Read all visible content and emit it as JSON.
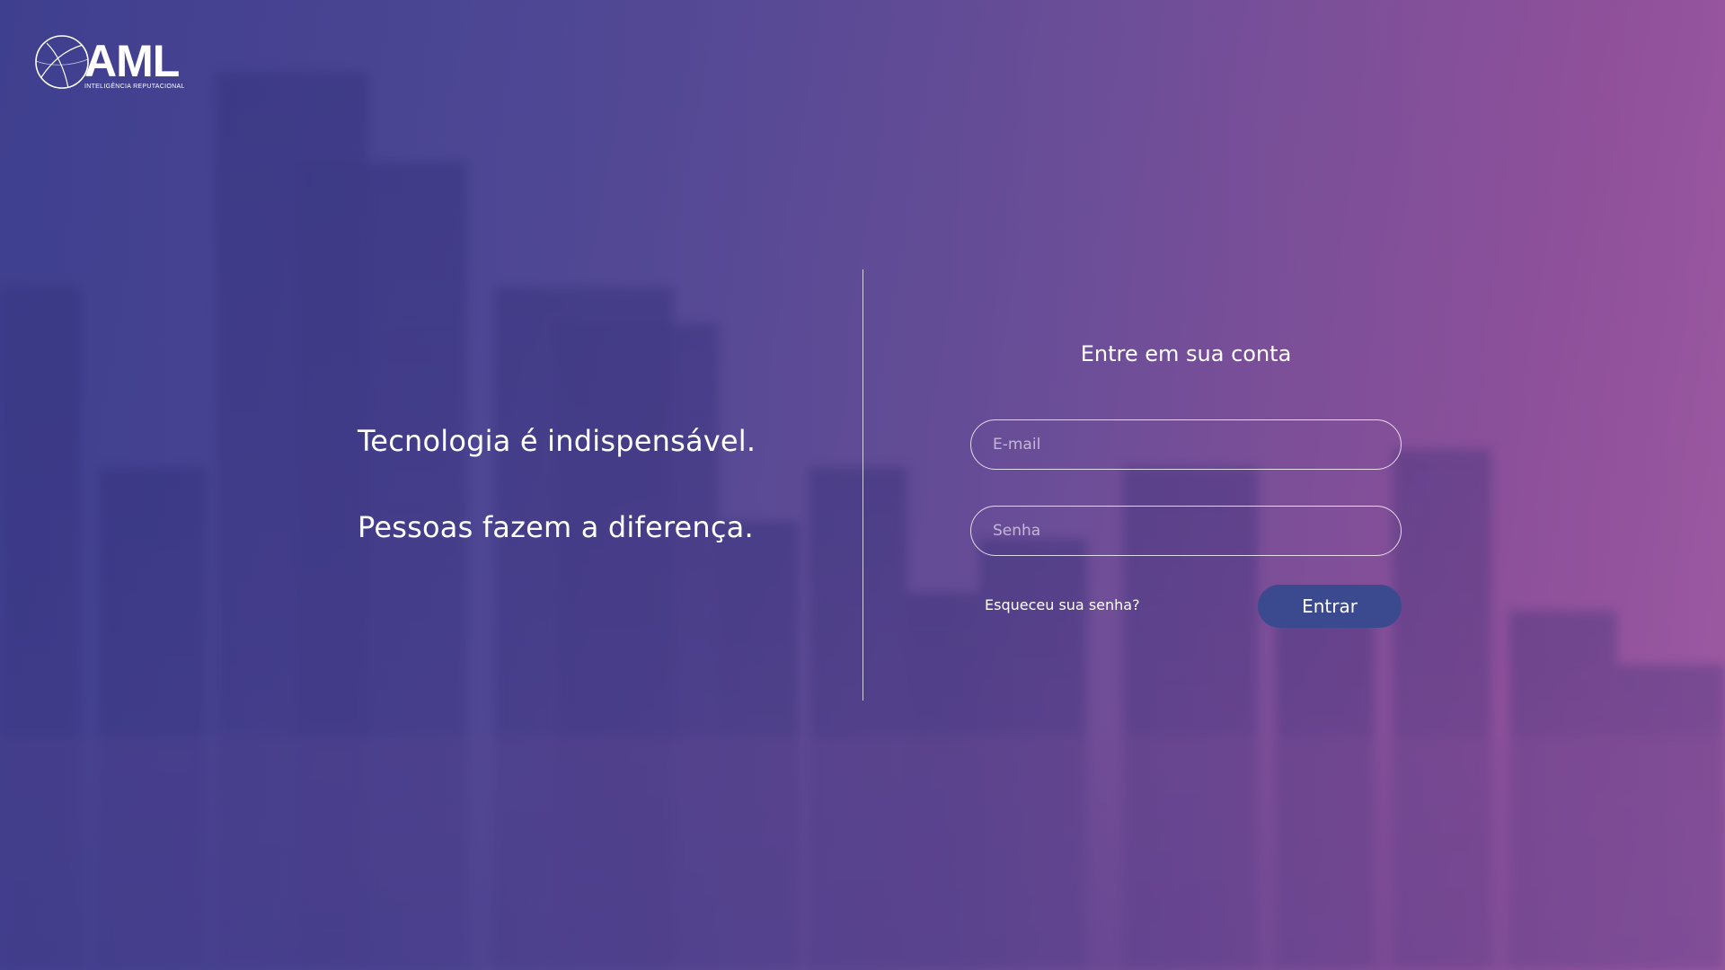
{
  "brand": {
    "logo_text": "AML",
    "tagline": "INTELIGÊNCIA REPUTACIONAL",
    "logo_icon": "globe-icon"
  },
  "hero": {
    "line1": "Tecnologia é indispensável.",
    "line2": "Pessoas fazem a diferença."
  },
  "login": {
    "title": "Entre em sua conta",
    "email_placeholder": "E-mail",
    "email_value": "",
    "password_placeholder": "Senha",
    "password_value": "",
    "forgot_label": "Esqueceu sua senha?",
    "submit_label": "Entrar"
  },
  "colors": {
    "button": "#3b4a8f",
    "text": "#ffffff",
    "gradient_start": "#3f3f8f",
    "gradient_end": "#9a5aa0"
  }
}
